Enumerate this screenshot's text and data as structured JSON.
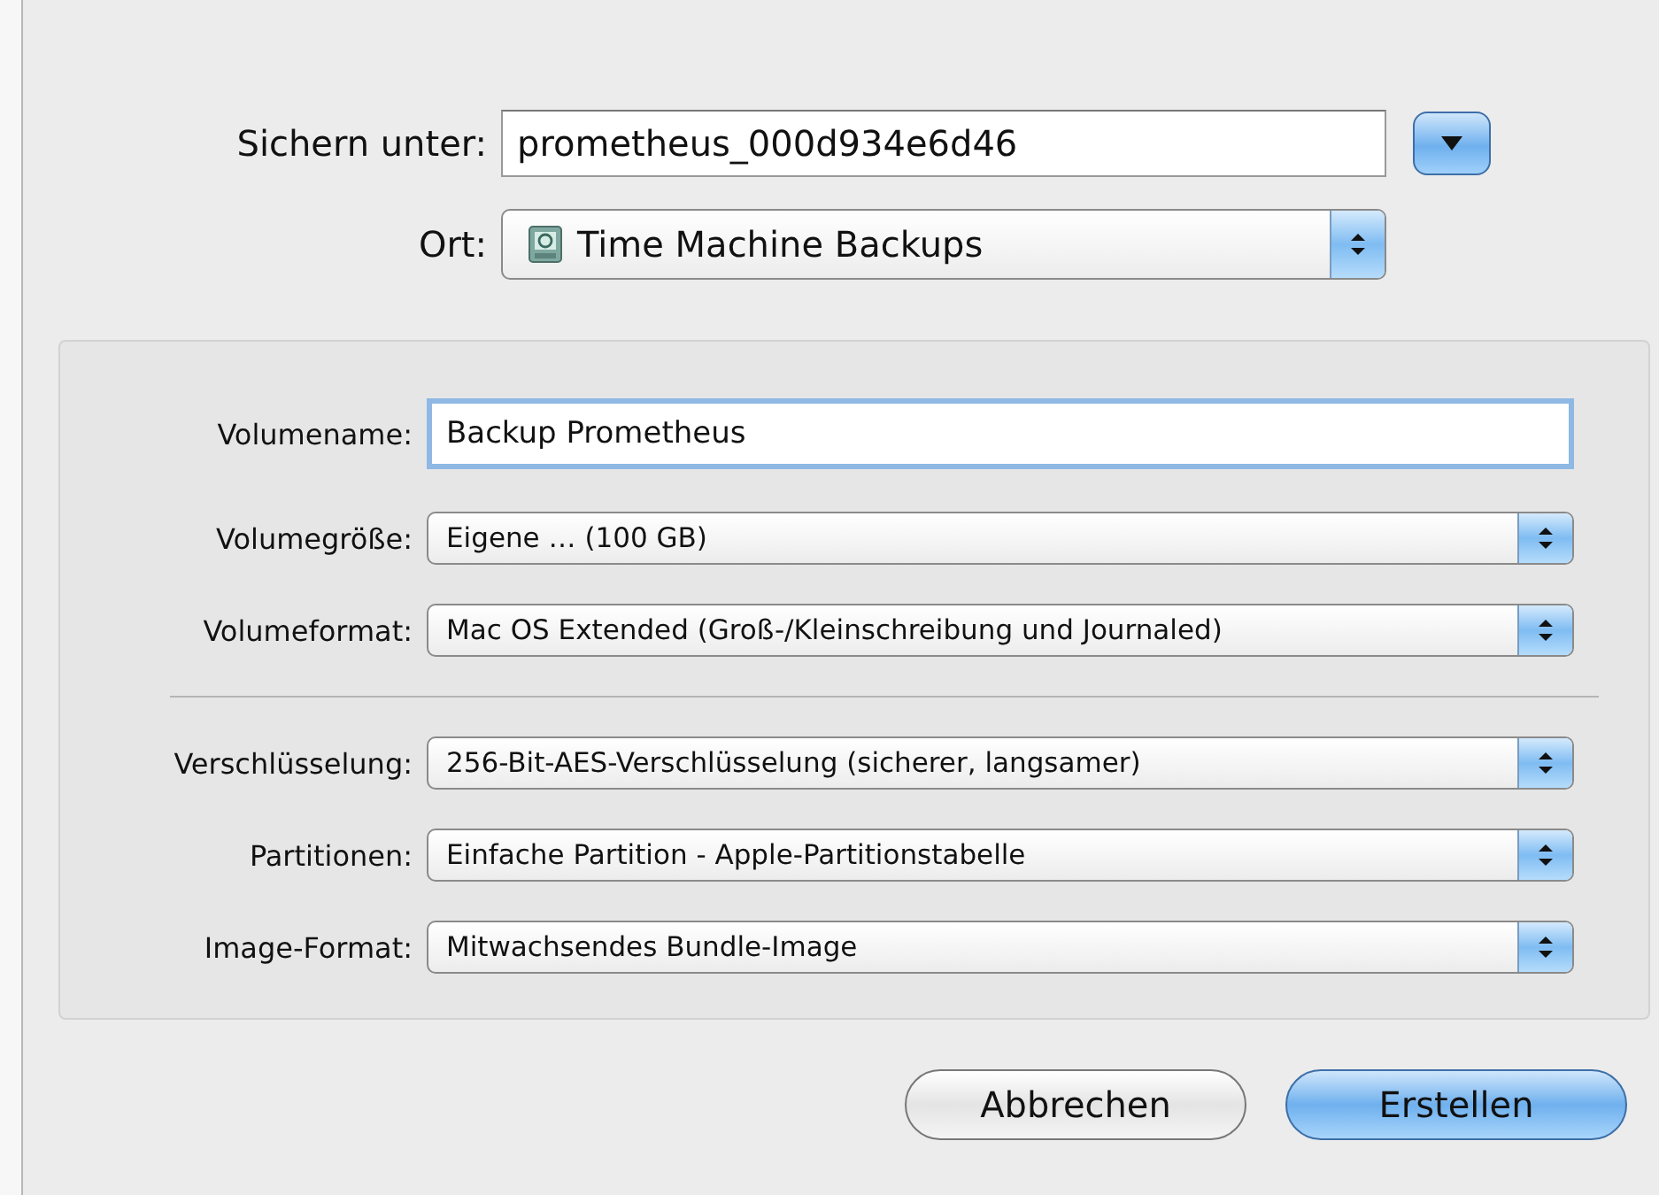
{
  "save_as": {
    "label": "Sichern unter:",
    "value": "prometheus_000d934e6d46",
    "expanded": false
  },
  "location": {
    "label": "Ort:",
    "value": "Time Machine Backups"
  },
  "options": {
    "groups": [
      [
        {
          "kind": "text",
          "label": "Volumename:",
          "value": "Backup Prometheus",
          "focused": true
        },
        {
          "kind": "popup",
          "label": "Volumegröße:",
          "value": "Eigene … (100 GB)"
        },
        {
          "kind": "popup",
          "label": "Volumeformat:",
          "value": "Mac OS Extended (Groß-/Kleinschreibung und Journaled)"
        }
      ],
      [
        {
          "kind": "popup",
          "label": "Verschlüsselung:",
          "value": "256-Bit-AES-Verschlüsselung (sicherer, langsamer)"
        },
        {
          "kind": "popup",
          "label": "Partitionen:",
          "value": "Einfache Partition - Apple-Partitionstabelle"
        },
        {
          "kind": "popup",
          "label": "Image-Format:",
          "value": "Mitwachsendes Bundle-Image"
        }
      ]
    ]
  },
  "buttons": [
    {
      "label": "Abbrechen",
      "default": false
    },
    {
      "label": "Erstellen",
      "default": true
    }
  ]
}
